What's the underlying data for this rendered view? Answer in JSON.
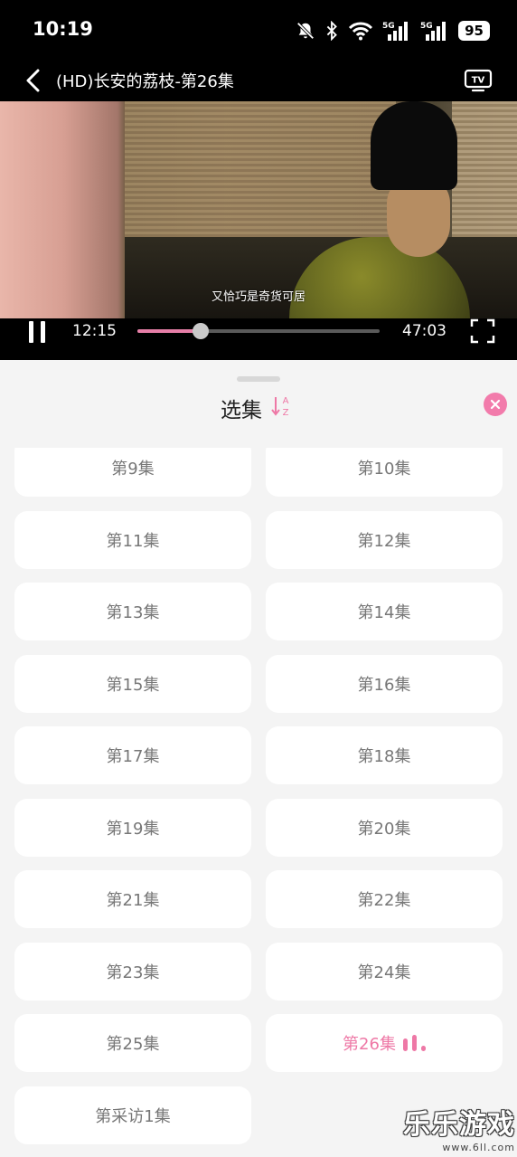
{
  "status_bar": {
    "time": "10:19",
    "icons": [
      "mute-bell-icon",
      "bluetooth-icon",
      "wifi-icon",
      "signal-5g-icon",
      "signal-5g-icon"
    ],
    "network_labels": [
      "5G",
      "5G"
    ],
    "battery": "95"
  },
  "header": {
    "title": "(HD)长安的荔枝-第26集",
    "back_icon": "chevron-left-icon",
    "tv_icon": "tv-cast-icon",
    "tv_label": "TV"
  },
  "player": {
    "subtitle": "又恰巧是奇货可居",
    "current_time": "12:15",
    "duration": "47:03",
    "progress_fraction": 0.26,
    "accent_color": "#e77fa8"
  },
  "episode_sheet": {
    "title": "选集",
    "sort_labels": [
      "A",
      "Z"
    ],
    "close_icon": "close-icon",
    "accent_color": "#ee78a6",
    "episodes": [
      {
        "label": "第9集",
        "active": false
      },
      {
        "label": "第10集",
        "active": false
      },
      {
        "label": "第11集",
        "active": false
      },
      {
        "label": "第12集",
        "active": false
      },
      {
        "label": "第13集",
        "active": false
      },
      {
        "label": "第14集",
        "active": false
      },
      {
        "label": "第15集",
        "active": false
      },
      {
        "label": "第16集",
        "active": false
      },
      {
        "label": "第17集",
        "active": false
      },
      {
        "label": "第18集",
        "active": false
      },
      {
        "label": "第19集",
        "active": false
      },
      {
        "label": "第20集",
        "active": false
      },
      {
        "label": "第21集",
        "active": false
      },
      {
        "label": "第22集",
        "active": false
      },
      {
        "label": "第23集",
        "active": false
      },
      {
        "label": "第24集",
        "active": false
      },
      {
        "label": "第25集",
        "active": false
      },
      {
        "label": "第26集",
        "active": true
      },
      {
        "label": "第采访1集",
        "active": false
      }
    ]
  },
  "watermark": {
    "text": "乐乐游戏",
    "url": "www.6ll.com"
  }
}
